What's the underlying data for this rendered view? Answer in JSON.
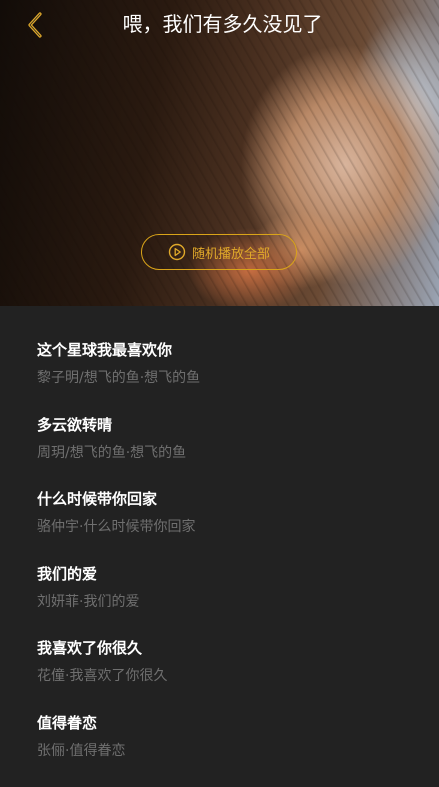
{
  "header": {
    "back_icon": "chevron-left-icon",
    "title": "喂，我们有多久没见了"
  },
  "colors": {
    "accent": "#d9a419",
    "background": "#222222",
    "title_text": "#ffffff",
    "meta_text": "#6f6f6f"
  },
  "shuffle": {
    "icon": "play-circle-icon",
    "label": "随机播放全部"
  },
  "songs": [
    {
      "title": "这个星球我最喜欢你",
      "meta": "黎子明/想飞的鱼·想飞的鱼"
    },
    {
      "title": "多云欲转晴",
      "meta": "周玥/想飞的鱼·想飞的鱼"
    },
    {
      "title": "什么时候带你回家",
      "meta": "骆仲宇·什么时候带你回家"
    },
    {
      "title": "我们的爱",
      "meta": "刘妍菲·我们的爱"
    },
    {
      "title": "我喜欢了你很久",
      "meta": "花僮·我喜欢了你很久"
    },
    {
      "title": "值得眷恋",
      "meta": "张俪·值得眷恋"
    }
  ]
}
